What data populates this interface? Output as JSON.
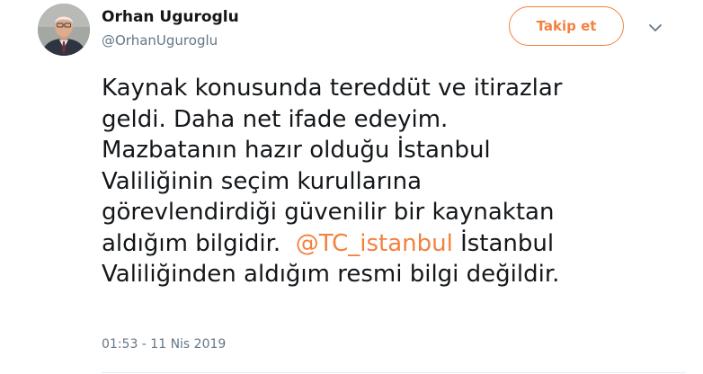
{
  "author": {
    "name": "Orhan Uguroglu",
    "handle": "@OrhanUguroglu"
  },
  "follow_button": {
    "label": "Takip et"
  },
  "menu": {
    "icon": "chevron-down-icon"
  },
  "tweet": {
    "lines": [
      "Kaynak konusunda tereddüt ve itirazlar",
      "geldi. Daha net ifade edeyim.",
      "Mazbatanın hazır olduğu İstanbul",
      "Valiliğinin seçim kurullarına",
      "görevlendirdiği güvenilir bir kaynaktan",
      "aldığım bilgidir.",
      "İstanbul",
      "Valiliğinden aldığım resmi bilgi değildir."
    ],
    "mention": "@TC_istanbul",
    "timestamp": "01:53 - 11 Nis 2019"
  },
  "colors": {
    "accent": "#f4813f",
    "text": "#14171a",
    "secondary": "#657786"
  }
}
